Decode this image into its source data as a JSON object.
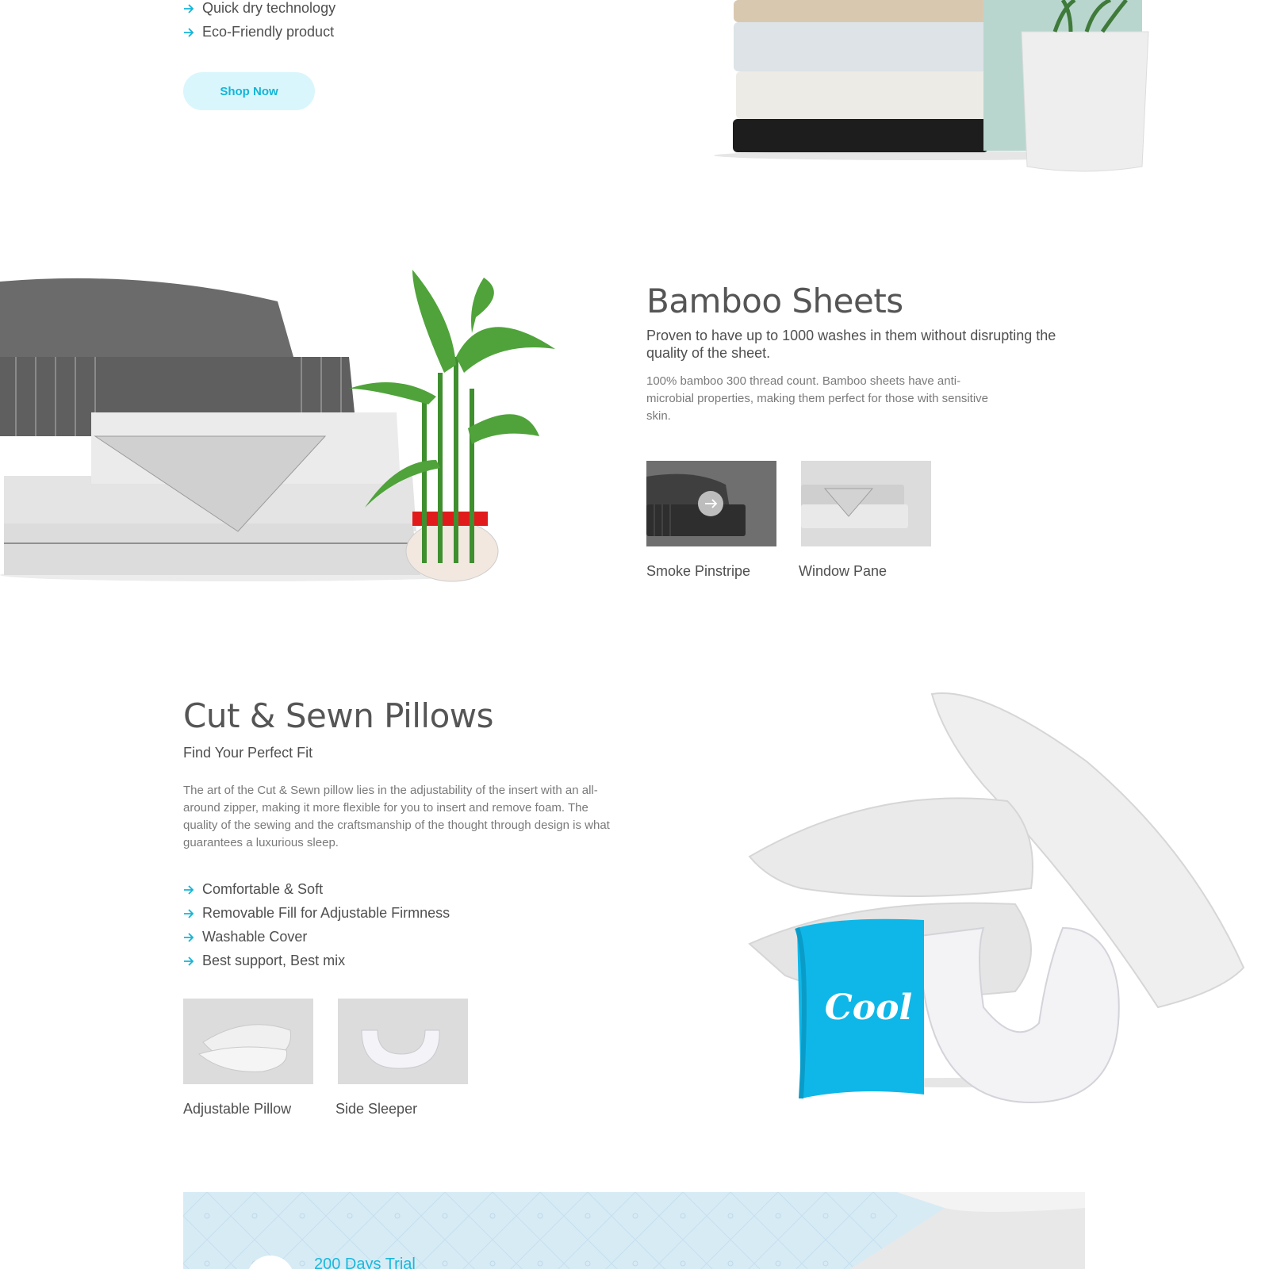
{
  "top_section": {
    "features": [
      "Quick dry technology",
      "Eco-Friendly product"
    ],
    "shop_button": "Shop Now"
  },
  "bamboo": {
    "title": "Bamboo Sheets",
    "subtitle": "Proven to have up to 1000 washes in them without disrupting the quality of the sheet.",
    "description": "100% bamboo 300 thread count. Bamboo sheets have anti-microbial properties, making them perfect for those with sensitive skin.",
    "variants": [
      {
        "label": "Smoke Pinstripe"
      },
      {
        "label": "Window Pane"
      }
    ]
  },
  "pillows": {
    "title": "Cut & Sewn Pillows",
    "subtitle": "Find Your Perfect Fit",
    "description": "The art of the Cut & Sewn pillow lies in the adjustability of the insert with an all-around zipper, making it more flexible for you to insert and remove foam. The quality of the sewing and the craftsmanship of the thought through design is what guarantees a luxurious sleep.",
    "features": [
      "Comfortable & Soft",
      "Removable Fill for Adjustable Firmness",
      "Washable Cover",
      "Best support, Best mix"
    ],
    "variants": [
      {
        "label": "Adjustable Pillow"
      },
      {
        "label": "Side Sleeper"
      }
    ],
    "badge_text": "Cool"
  },
  "banner": {
    "title": "200 Days Trial"
  },
  "colors": {
    "accent": "#14b5d6",
    "button_bg": "#d9f6fc",
    "banner_bg": "#d7ebf5"
  }
}
